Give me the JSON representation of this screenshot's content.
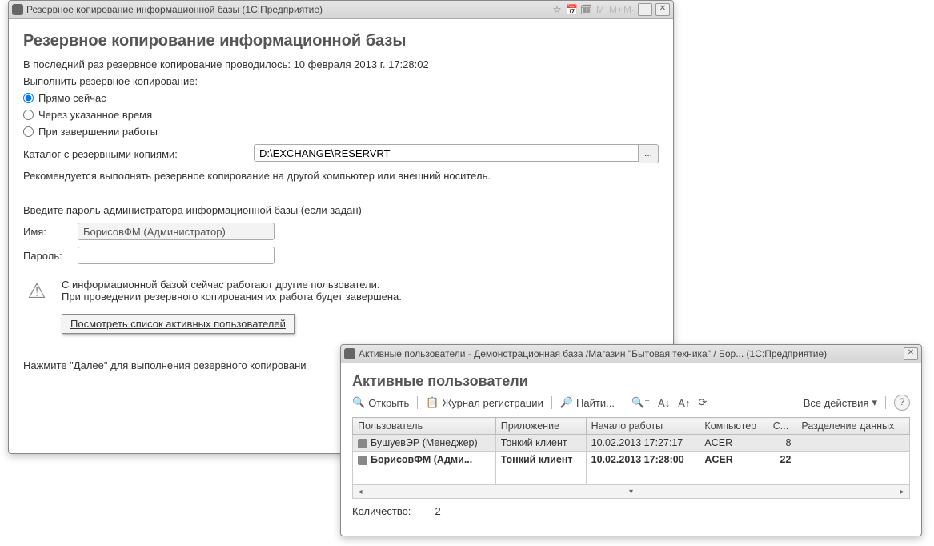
{
  "backup_window": {
    "title": "Резервное копирование информационной базы  (1С:Предприятие)",
    "heading": "Резервное копирование информационной базы",
    "last_run": "В последний раз резервное копирование проводилось: 10 февраля 2013 г. 17:28:02",
    "schedule_label": "Выполнить резервное копирование:",
    "radio_now": "Прямо сейчас",
    "radio_later": "Через указанное время",
    "radio_onexit": "При завершении работы",
    "path_label": "Каталог с резервными копиями:",
    "path_value": "D:\\EXCHANGE\\RESERVRT",
    "browse_label": "...",
    "recommend": "Рекомендуется выполнять резервное копирование на другой компьютер или внешний носитель.",
    "cred_prompt": "Введите пароль администратора информационной базы (если задан)",
    "name_label": "Имя:",
    "name_value": "БорисовФМ (Администратор)",
    "pass_label": "Пароль:",
    "pass_value": "",
    "warn_line1": "С информационной базой сейчас работают другие пользователи.",
    "warn_line2": "При проведении резервного копирования их работа будет завершена.",
    "link_label": "Посмотреть список активных пользователей",
    "next_hint": "Нажмите \"Далее\" для выполнения резервного копировани"
  },
  "users_window": {
    "title": "Активные пользователи - Демонстрационная база /Магазин \"Бытовая техника\" / Бор...  (1С:Предприятие)",
    "heading": "Активные пользователи",
    "toolbar": {
      "open": "Открыть",
      "journal": "Журнал регистрации",
      "find": "Найти...",
      "all_actions": "Все действия"
    },
    "columns": [
      "Пользователь",
      "Приложение",
      "Начало работы",
      "Компьютер",
      "С...",
      "Разделение данных"
    ],
    "rows": [
      {
        "user": "БушуевЭР (Менеджер)",
        "app": "Тонкий клиент",
        "start": "10.02.2013 17:27:17",
        "comp": "ACER",
        "sess": "8",
        "sep": ""
      },
      {
        "user": "БорисовФМ (Адми...",
        "app": "Тонкий клиент",
        "start": "10.02.2013 17:28:00",
        "comp": "ACER",
        "sess": "22",
        "sep": ""
      }
    ],
    "count_label": "Количество:",
    "count_value": "2"
  }
}
